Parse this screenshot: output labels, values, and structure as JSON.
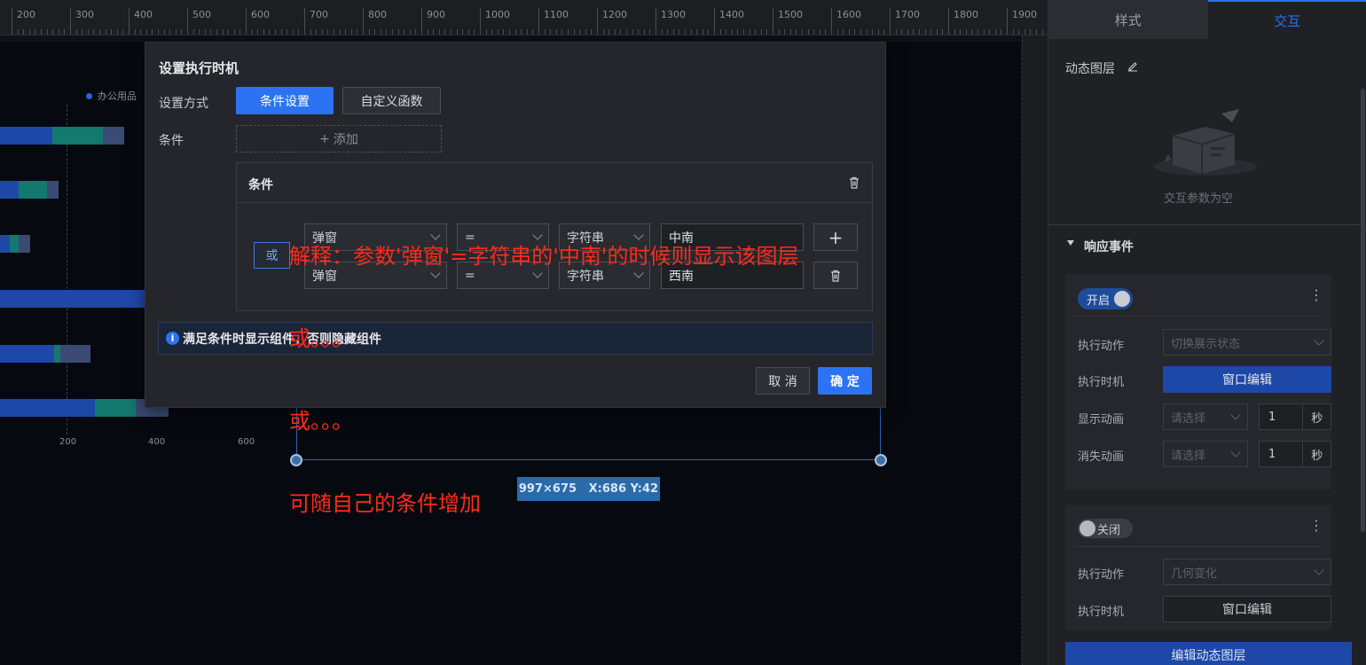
{
  "ruler": {
    "ticks": [
      "200",
      "300",
      "400",
      "500",
      "600",
      "700",
      "800",
      "900",
      "1000",
      "1100",
      "1200",
      "1300",
      "1400",
      "1500",
      "1600",
      "1700",
      "1800",
      "1900"
    ]
  },
  "chart": {
    "legend_label": "办公用品",
    "axis_labels": [
      "200",
      "400",
      "600"
    ],
    "colors": {
      "series1": "#1e48a8",
      "series2": "#13786e",
      "series3": "#3b4a73"
    }
  },
  "selection": {
    "size_label": "997×675   X:686 Y:42"
  },
  "dialog": {
    "title": "设置执行时机",
    "mode_label": "设置方式",
    "mode_primary": "条件设置",
    "mode_secondary": "自定义函数",
    "condition_label": "条件",
    "add_label": "添加",
    "panel_title": "条件",
    "or_label": "或",
    "rows": [
      {
        "param": "弹窗",
        "operator": "=",
        "type": "字符串",
        "value": "中南"
      },
      {
        "param": "弹窗",
        "operator": "=",
        "type": "字符串",
        "value": "西南"
      }
    ],
    "info_text": "满足条件时显示组件，否则隐藏组件",
    "cancel_label": "取 消",
    "ok_label": "确 定"
  },
  "annotation": {
    "line1": "解释：参数'弹窗'=字符串的'中南'的时候则显示该图层",
    "line2": "或。。。",
    "line3": "或。。。",
    "line4": "可随自己的条件增加"
  },
  "right_panel": {
    "tab_style": "样式",
    "tab_interaction": "交互",
    "dynamic_layer_label": "动态图层",
    "empty_text": "交互参数为空",
    "section_title": "响应事件",
    "event1": {
      "toggle_label": "开启",
      "action_label": "执行动作",
      "action_value": "切换展示状态",
      "timing_label": "执行时机",
      "timing_button": "窗口编辑",
      "show_anim_label": "显示动画",
      "show_anim_placeholder": "请选择",
      "show_anim_duration": "1",
      "hide_anim_label": "消失动画",
      "hide_anim_placeholder": "请选择",
      "hide_anim_duration": "1",
      "unit": "秒"
    },
    "event2": {
      "toggle_label": "关闭",
      "action_label": "执行动作",
      "action_value": "几何变化",
      "timing_label": "执行时机",
      "timing_button": "窗口编辑"
    },
    "edit_button": "编辑动态图层"
  }
}
